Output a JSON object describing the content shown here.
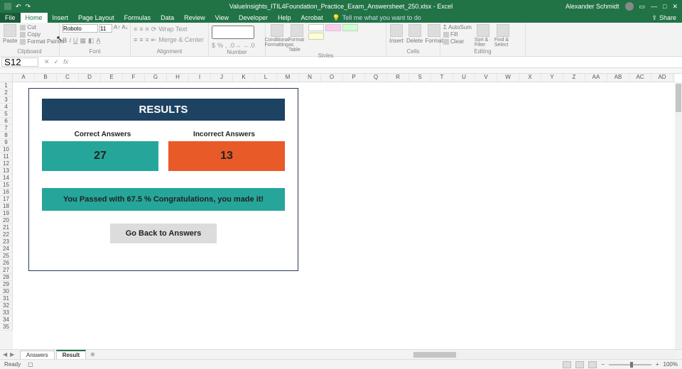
{
  "titlebar": {
    "filename": "ValueInsights_ITIL4Foundation_Practice_Exam_Answersheet_250.xlsx - Excel",
    "user": "Alexander Schmidt"
  },
  "menu": {
    "file": "File",
    "home": "Home",
    "insert": "Insert",
    "pagelayout": "Page Layout",
    "formulas": "Formulas",
    "data": "Data",
    "review": "Review",
    "view": "View",
    "developer": "Developer",
    "help": "Help",
    "acrobat": "Acrobat",
    "tellme": "Tell me what you want to do",
    "share": "Share"
  },
  "ribbon": {
    "clipboard": {
      "paste": "Paste",
      "cut": "Cut",
      "copy": "Copy",
      "fp": "Format Painter",
      "label": "Clipboard"
    },
    "font": {
      "name": "Roboto",
      "size": "11",
      "label": "Font"
    },
    "alignment": {
      "wrap": "Wrap Text",
      "merge": "Merge & Center",
      "label": "Alignment"
    },
    "number": {
      "label": "Number"
    },
    "styles": {
      "cf": "Conditional Formatting",
      "ft": "Format as Table",
      "label": "Styles"
    },
    "cells": {
      "ins": "Insert",
      "del": "Delete",
      "fmt": "Format",
      "label": "Cells"
    },
    "editing": {
      "sum": "AutoSum",
      "fill": "Fill",
      "clear": "Clear",
      "sort": "Sort & Filter",
      "find": "Find & Select",
      "label": "Editing"
    }
  },
  "namebox": "S12",
  "cols": [
    "A",
    "B",
    "C",
    "D",
    "E",
    "F",
    "G",
    "H",
    "I",
    "J",
    "K",
    "L",
    "M",
    "N",
    "O",
    "P",
    "Q",
    "R",
    "S",
    "T",
    "U",
    "V",
    "W",
    "X",
    "Y",
    "Z",
    "AA",
    "AB",
    "AC",
    "AD"
  ],
  "rows": [
    "1",
    "2",
    "3",
    "4",
    "5",
    "6",
    "7",
    "8",
    "9",
    "10",
    "11",
    "12",
    "13",
    "14",
    "15",
    "16",
    "17",
    "18",
    "19",
    "20",
    "21",
    "22",
    "23",
    "24",
    "25",
    "26",
    "27",
    "28",
    "29",
    "30",
    "31",
    "32",
    "33",
    "34",
    "35"
  ],
  "results": {
    "title": "RESULTS",
    "correct_label": "Correct Answers",
    "incorrect_label": "Incorrect Answers",
    "correct": "27",
    "incorrect": "13",
    "pass_msg": "You Passed with 67.5 % Congratulations, you made it!",
    "back": "Go Back to Answers"
  },
  "sheets": {
    "answers": "Answers",
    "result": "Result"
  },
  "status": {
    "ready": "Ready",
    "zoom": "100%"
  }
}
